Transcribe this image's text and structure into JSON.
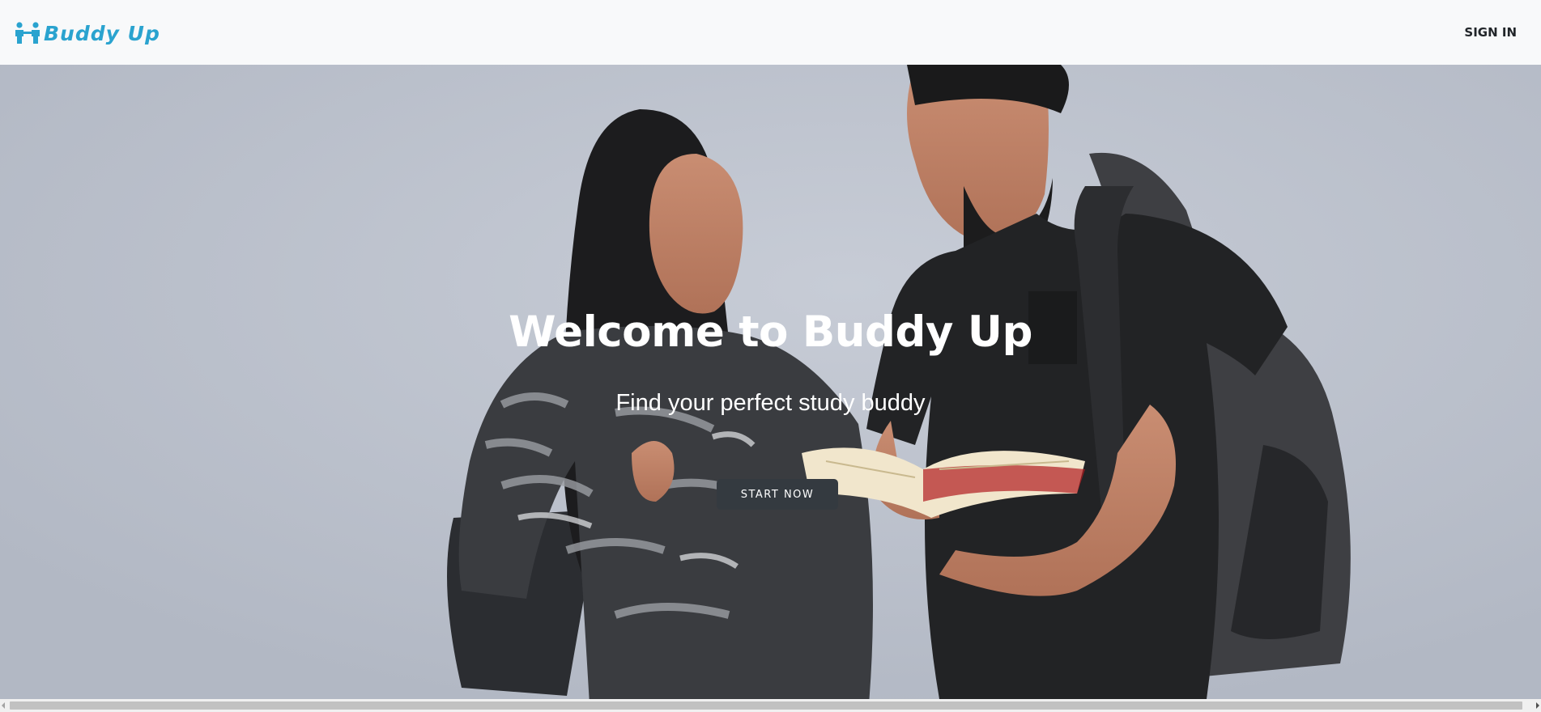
{
  "navbar": {
    "brand_text": "Buddy Up",
    "brand_icon": "people-connect-icon",
    "signin_label": "SIGN IN"
  },
  "hero": {
    "title": "Welcome to Buddy Up",
    "subtitle": "Find your perfect study buddy",
    "cta_label": "START NOW",
    "image_alt": "Two students with backpacks reading a book together"
  },
  "colors": {
    "brand": "#2aa3cf",
    "navbar_bg": "#f8f9fa",
    "cta_bg": "#343a40"
  }
}
